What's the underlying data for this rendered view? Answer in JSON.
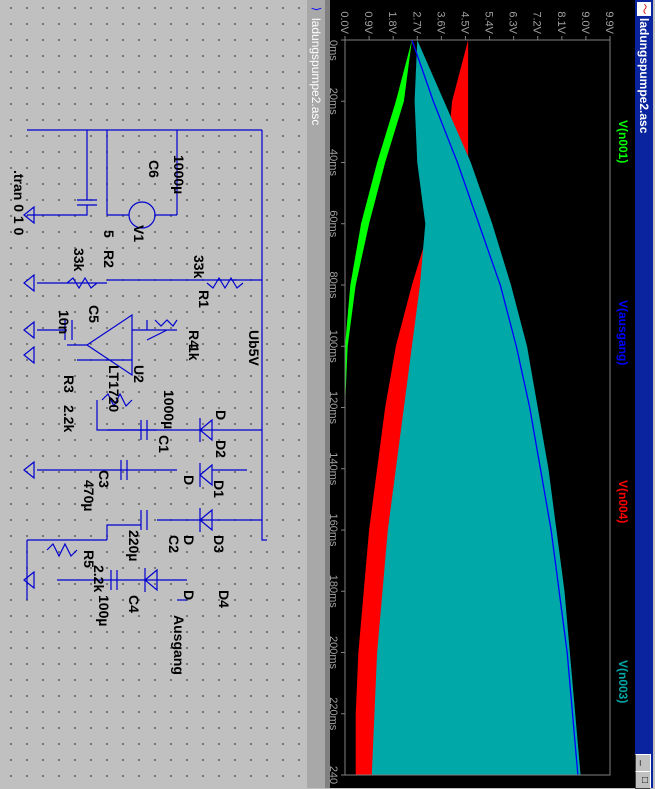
{
  "plot_window": {
    "title": "ladungspumpe2.asc",
    "app_icon": "ltspice-waveform-icon",
    "buttons": [
      "_",
      "□"
    ]
  },
  "schematic_window": {
    "title": "ladungspumpe2.asc",
    "app_icon": "ltspice-schematic-icon"
  },
  "chart_data": {
    "type": "line",
    "x_axis": {
      "ticks": [
        "0ms",
        "20ms",
        "40ms",
        "60ms",
        "80ms",
        "100ms",
        "120ms",
        "140ms",
        "160ms",
        "180ms",
        "200ms",
        "220ms",
        "240"
      ],
      "range": [
        0,
        240
      ]
    },
    "y_axis": {
      "ticks": [
        "0.0V",
        "0.9V",
        "1.8V",
        "2.7V",
        "3.6V",
        "4.5V",
        "5.4V",
        "6.3V",
        "7.2V",
        "8.1V",
        "9.0V",
        "9.9V"
      ],
      "range": [
        0,
        9.9
      ]
    },
    "grid": false,
    "series": [
      {
        "name": "V(n001)",
        "color": "#00ff00",
        "envelope_max": [
          [
            0,
            2.5
          ],
          [
            20,
            2.2
          ],
          [
            40,
            1.5
          ],
          [
            60,
            0.9
          ],
          [
            80,
            0.4
          ],
          [
            100,
            0.1
          ],
          [
            120,
            0.0
          ],
          [
            140,
            0.0
          ],
          [
            160,
            0.0
          ],
          [
            180,
            0.0
          ],
          [
            200,
            0.0
          ],
          [
            220,
            0.0
          ],
          [
            240,
            0.0
          ]
        ],
        "envelope_min": [
          [
            0,
            2.5
          ],
          [
            20,
            1.9
          ],
          [
            40,
            1.2
          ],
          [
            60,
            0.6
          ],
          [
            80,
            0.2
          ],
          [
            100,
            0.0
          ],
          [
            120,
            0.0
          ],
          [
            140,
            0.0
          ],
          [
            160,
            0.0
          ],
          [
            180,
            0.0
          ],
          [
            200,
            0.0
          ],
          [
            220,
            0.0
          ],
          [
            240,
            0.0
          ]
        ]
      },
      {
        "name": "V(ausgang)",
        "color": "#0000ff",
        "points": [
          [
            0,
            2.5
          ],
          [
            20,
            3.3
          ],
          [
            40,
            4.2
          ],
          [
            60,
            5.0
          ],
          [
            80,
            5.8
          ],
          [
            100,
            6.4
          ],
          [
            120,
            6.9
          ],
          [
            140,
            7.3
          ],
          [
            160,
            7.7
          ],
          [
            180,
            8.0
          ],
          [
            200,
            8.3
          ],
          [
            220,
            8.5
          ],
          [
            240,
            8.7
          ]
        ]
      },
      {
        "name": "V(n004)",
        "color": "#ff0000",
        "envelope_max": [
          [
            0,
            4.6
          ],
          [
            40,
            4.6
          ],
          [
            60,
            4.6
          ],
          [
            100,
            4.6
          ],
          [
            140,
            4.6
          ],
          [
            240,
            4.6
          ]
        ],
        "envelope_min": [
          [
            0,
            4.6
          ],
          [
            20,
            4.0
          ],
          [
            40,
            3.8
          ],
          [
            60,
            3.2
          ],
          [
            80,
            2.5
          ],
          [
            100,
            1.9
          ],
          [
            120,
            1.5
          ],
          [
            140,
            1.2
          ],
          [
            160,
            0.9
          ],
          [
            180,
            0.7
          ],
          [
            200,
            0.5
          ],
          [
            220,
            0.4
          ],
          [
            240,
            0.4
          ]
        ]
      },
      {
        "name": "V(n003)",
        "color": "#00a8a8",
        "envelope_max": [
          [
            0,
            2.7
          ],
          [
            20,
            3.7
          ],
          [
            40,
            4.7
          ],
          [
            60,
            5.5
          ],
          [
            80,
            6.2
          ],
          [
            100,
            6.8
          ],
          [
            120,
            7.2
          ],
          [
            140,
            7.6
          ],
          [
            160,
            7.9
          ],
          [
            180,
            8.2
          ],
          [
            200,
            8.4
          ],
          [
            220,
            8.6
          ],
          [
            240,
            8.8
          ]
        ],
        "envelope_min": [
          [
            0,
            2.7
          ],
          [
            20,
            2.6
          ],
          [
            40,
            2.7
          ],
          [
            60,
            3.0
          ],
          [
            80,
            2.8
          ],
          [
            100,
            2.5
          ],
          [
            120,
            2.2
          ],
          [
            140,
            1.9
          ],
          [
            160,
            1.6
          ],
          [
            180,
            1.4
          ],
          [
            200,
            1.2
          ],
          [
            220,
            1.1
          ],
          [
            240,
            1.0
          ]
        ]
      }
    ]
  },
  "schematic": {
    "labels": {
      "c6": "C6",
      "c6_val": "1000µ",
      "v1": "V1",
      "v1_val": "5",
      "r1": "R1",
      "r1_val": "33k",
      "r2": "R2",
      "r2_val": "33k",
      "r4": "R4",
      "r4_val": "1k",
      "c5": "C5",
      "c5_val": "10n",
      "u2": "U2",
      "u2_val": "LT1720",
      "r3": "R3",
      "r3_val": "2.2k",
      "ub": "Ub5V",
      "d_top": "D",
      "d2": "D2",
      "c1_val": "1000µ",
      "c1": "C1",
      "c3": "C3",
      "c3_val": "470µ",
      "d1": "D1",
      "d1_val": "D",
      "d3": "D3",
      "d3_val": "D",
      "c2": "C2",
      "c2_val": "220µ",
      "d4": "D4",
      "d4_val": "D",
      "r5": "R5",
      "r5_val": "2.2k",
      "c4": "C4",
      "c4_val": "100µ",
      "ausgang": "Ausgang",
      "tran": ".tran 0 1 0"
    }
  }
}
